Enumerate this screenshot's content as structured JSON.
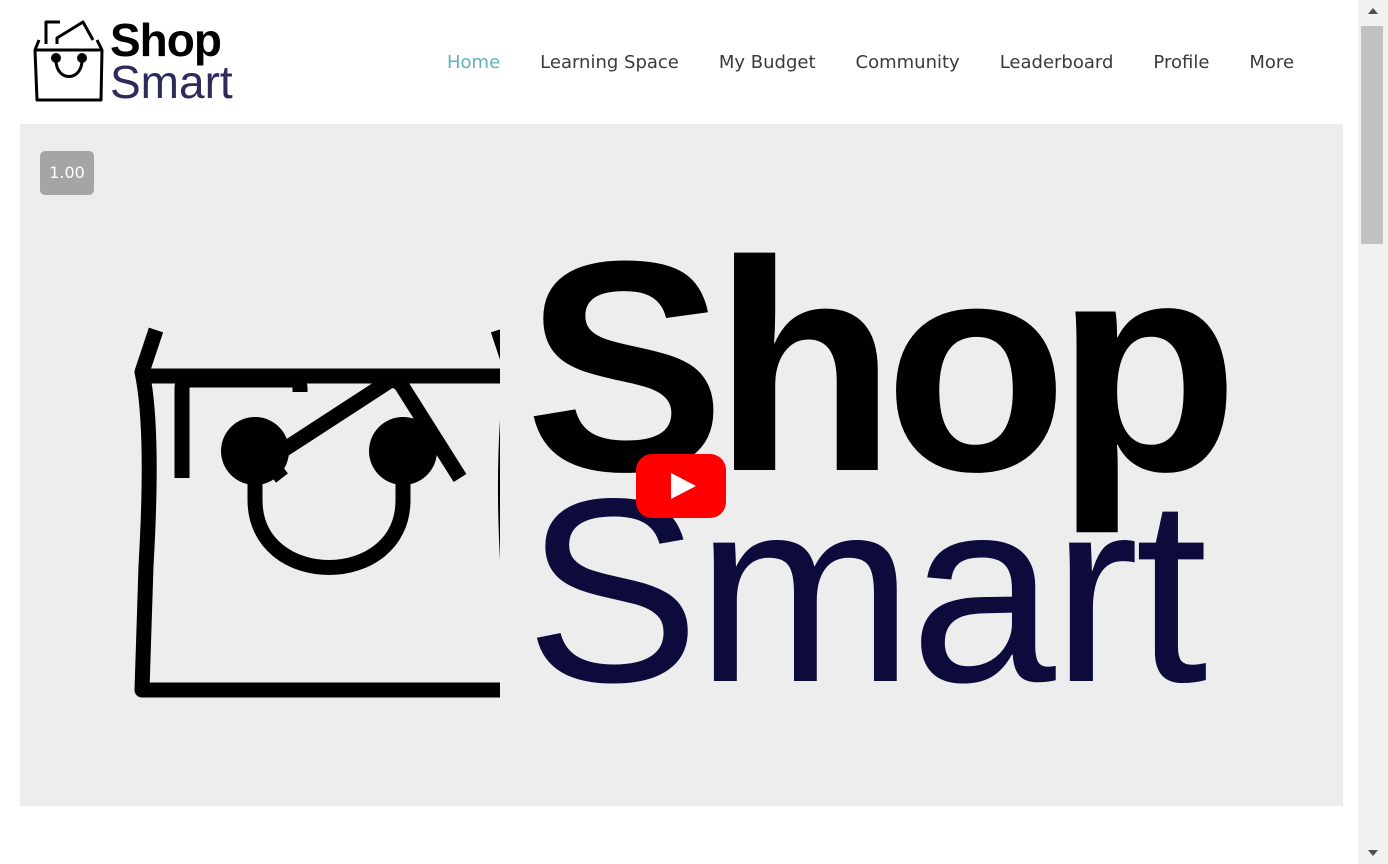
{
  "brand": {
    "name_top": "Shop",
    "name_bottom": "Smart",
    "colors": {
      "black": "#000000",
      "navy": "#2d2a5c",
      "accent": "#5fb3b9"
    }
  },
  "nav": {
    "items": [
      {
        "label": "Home",
        "active": true
      },
      {
        "label": "Learning Space",
        "active": false
      },
      {
        "label": "My Budget",
        "active": false
      },
      {
        "label": "Community",
        "active": false
      },
      {
        "label": "Leaderboard",
        "active": false
      },
      {
        "label": "Profile",
        "active": false
      },
      {
        "label": "More",
        "active": false
      }
    ]
  },
  "video": {
    "speed": "1.00",
    "title_top": "Shop",
    "title_bottom": "Smart",
    "play_icon": "youtube-play-icon",
    "play_color": "#ff0000"
  },
  "scrollbar": {
    "up_icon": "arrow-up-icon",
    "down_icon": "arrow-down-icon"
  }
}
